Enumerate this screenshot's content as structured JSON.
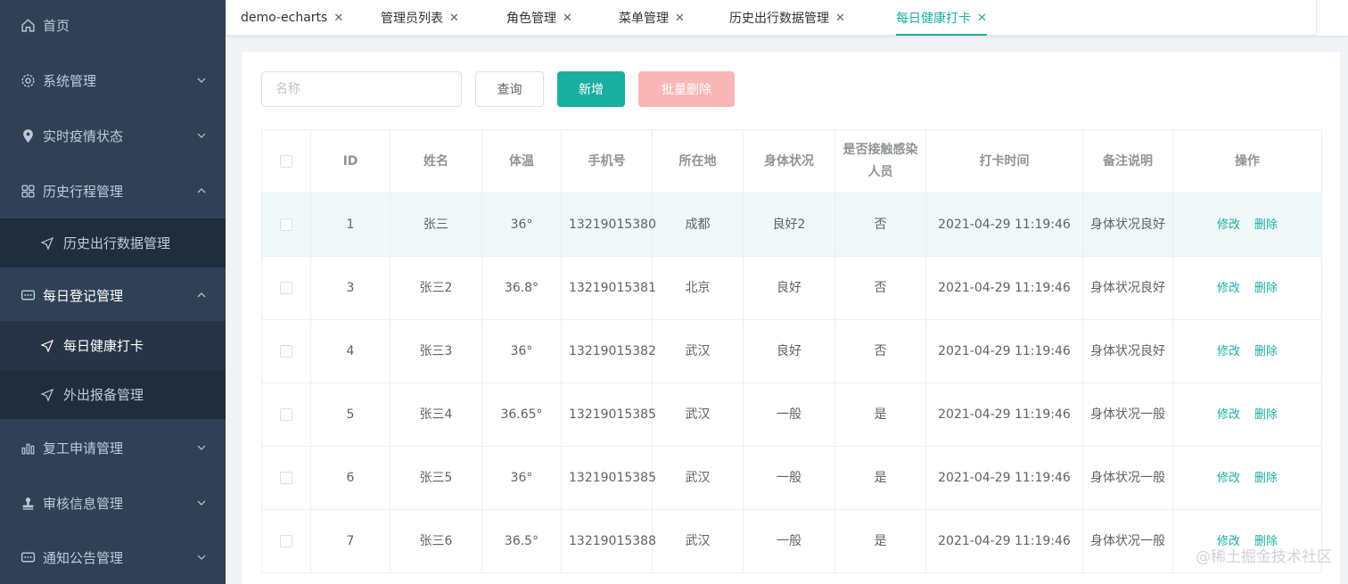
{
  "sidebar": {
    "home": "首页",
    "system": "系统管理",
    "epidemic": "实时疫情状态",
    "history": "历史行程管理",
    "history_sub": "历史出行数据管理",
    "daily": "每日登记管理",
    "daily_sub1": "每日健康打卡",
    "daily_sub2": "外出报备管理",
    "resume": "复工申请管理",
    "audit": "审核信息管理",
    "notice": "通知公告管理"
  },
  "tabs": [
    {
      "label": "demo-echarts",
      "close": "✕"
    },
    {
      "label": "管理员列表",
      "close": "✕"
    },
    {
      "label": "角色管理",
      "close": "✕"
    },
    {
      "label": "菜单管理",
      "close": "✕"
    },
    {
      "label": "历史出行数据管理",
      "close": "✕"
    },
    {
      "label": "每日健康打卡",
      "close": "✕"
    }
  ],
  "toolbar": {
    "search_placeholder": "名称",
    "query": "查询",
    "add": "新增",
    "batch_delete": "批量删除"
  },
  "table": {
    "headers": [
      "ID",
      "姓名",
      "体温",
      "手机号",
      "所在地",
      "身体状况",
      "是否接触感染人员",
      "打卡时间",
      "备注说明",
      "操作"
    ],
    "rows": [
      {
        "id": "1",
        "name": "张三",
        "temp": "36°",
        "phone": "13219015380",
        "location": "成都",
        "condition": "良好2",
        "contact": "否",
        "time": "2021-04-29 11:19:46",
        "note": "身体状况良好"
      },
      {
        "id": "3",
        "name": "张三2",
        "temp": "36.8°",
        "phone": "13219015381",
        "location": "北京",
        "condition": "良好",
        "contact": "否",
        "time": "2021-04-29 11:19:46",
        "note": "身体状况良好"
      },
      {
        "id": "4",
        "name": "张三3",
        "temp": "36°",
        "phone": "13219015382",
        "location": "武汉",
        "condition": "良好",
        "contact": "否",
        "time": "2021-04-29 11:19:46",
        "note": "身体状况良好"
      },
      {
        "id": "5",
        "name": "张三4",
        "temp": "36.65°",
        "phone": "13219015385",
        "location": "武汉",
        "condition": "一般",
        "contact": "是",
        "time": "2021-04-29 11:19:46",
        "note": "身体状况一般"
      },
      {
        "id": "6",
        "name": "张三5",
        "temp": "36°",
        "phone": "13219015385",
        "location": "武汉",
        "condition": "一般",
        "contact": "是",
        "time": "2021-04-29 11:19:46",
        "note": "身体状况一般"
      },
      {
        "id": "7",
        "name": "张三6",
        "temp": "36.5°",
        "phone": "13219015388",
        "location": "武汉",
        "condition": "一般",
        "contact": "是",
        "time": "2021-04-29 11:19:46",
        "note": "身体状况一般"
      }
    ],
    "edit": "修改",
    "delete": "删除"
  },
  "watermark": "@稀土掘金技术社区",
  "colors": {
    "sidebar_bg": "#304156",
    "sub_bg": "#1f2d3d",
    "accent": "#1aae9f",
    "danger_disabled": "#fab6b6"
  }
}
